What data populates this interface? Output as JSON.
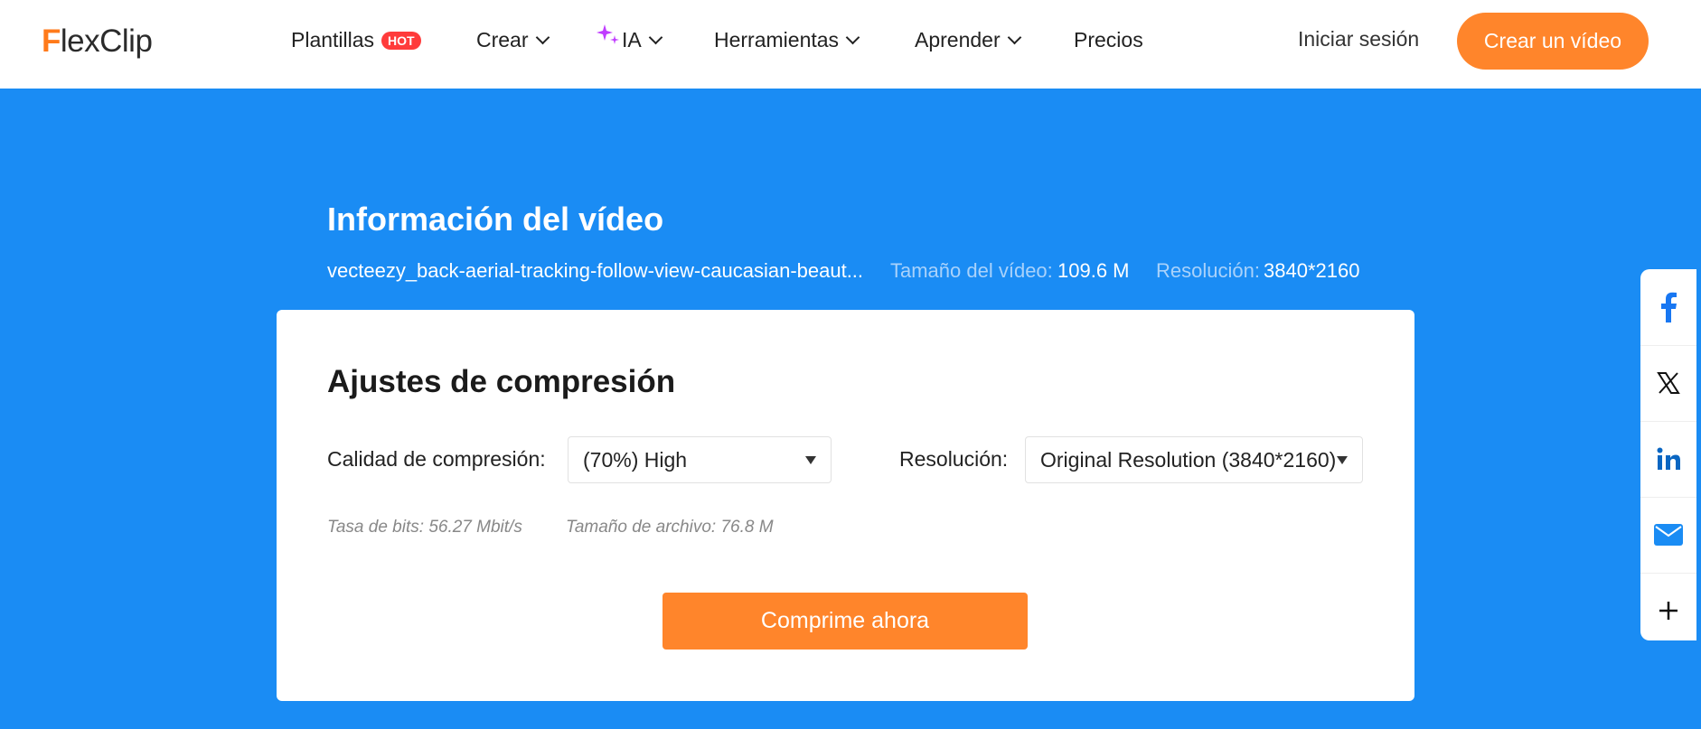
{
  "header": {
    "logo": {
      "first": "F",
      "rest": "lexClip"
    },
    "nav": [
      {
        "label": "Plantillas",
        "badge": "HOT"
      },
      {
        "label": "Crear"
      },
      {
        "label": "IA"
      },
      {
        "label": "Herramientas"
      },
      {
        "label": "Aprender"
      },
      {
        "label": "Precios"
      }
    ],
    "login": "Iniciar sesión",
    "cta": "Crear un vídeo"
  },
  "video_info": {
    "title": "Información del vídeo",
    "filename": "vecteezy_back-aerial-tracking-follow-view-caucasian-beaut...",
    "size_label": "Tamaño del vídeo:",
    "size_value": "109.6 M",
    "resolution_label": "Resolución:",
    "resolution_value": "3840*2160"
  },
  "compression": {
    "title": "Ajustes de compresión",
    "quality_label": "Calidad de compresión:",
    "quality_value": "(70%) High",
    "resolution_label": "Resolución:",
    "resolution_value": "Original Resolution (3840*2160)",
    "bitrate_label": "Tasa de bits:",
    "bitrate_value": "56.27 Mbit/s",
    "filesize_label": "Tamaño de archivo:",
    "filesize_value": "76.8 M",
    "button": "Comprime ahora"
  },
  "share": {
    "items": [
      "facebook-icon",
      "x-icon",
      "linkedin-icon",
      "email-icon",
      "plus-icon"
    ],
    "colors": {
      "facebook": "#1877f2",
      "linkedin": "#0a66c2",
      "email": "#1a8cf4"
    }
  },
  "colors": {
    "accent": "#ff852b",
    "hero_bg": "#1a8cf4",
    "hot": "#ff3b3b"
  }
}
